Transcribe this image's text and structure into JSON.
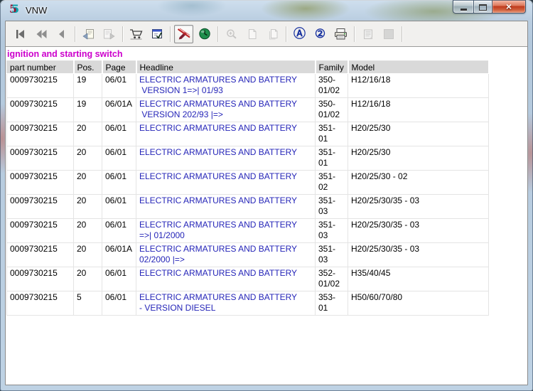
{
  "window": {
    "title": "VNW"
  },
  "caption_buttons": {
    "minimize": "minimize",
    "maximize": "maximize",
    "close": "close"
  },
  "toolbar": {
    "items": [
      {
        "icon": "go-first-icon",
        "enabled": true
      },
      {
        "icon": "go-previous-fast-icon",
        "enabled": true
      },
      {
        "icon": "go-previous-icon",
        "enabled": true
      },
      {
        "separator": true
      },
      {
        "icon": "document-back-icon",
        "enabled": true
      },
      {
        "icon": "document-forward-icon",
        "enabled": false
      },
      {
        "separator": true
      },
      {
        "icon": "shopping-cart-icon",
        "enabled": true
      },
      {
        "icon": "order-form-icon",
        "enabled": true
      },
      {
        "separator": true
      },
      {
        "icon": "no-edit-pen-icon",
        "enabled": true,
        "pressed": true
      },
      {
        "icon": "globe-clock-icon",
        "enabled": true
      },
      {
        "separator": true
      },
      {
        "icon": "zoom-in-icon",
        "enabled": false
      },
      {
        "icon": "page-blank-icon",
        "enabled": false
      },
      {
        "icon": "page-copy-icon",
        "enabled": false
      },
      {
        "separator": true
      },
      {
        "icon": "circled-a-icon",
        "enabled": true,
        "glyph": "Ⓐ"
      },
      {
        "icon": "circled-2-icon",
        "enabled": true,
        "glyph": "②"
      },
      {
        "icon": "printer-icon",
        "enabled": true
      },
      {
        "separator": true
      },
      {
        "icon": "notepad-icon",
        "enabled": false
      },
      {
        "icon": "stop-square-icon",
        "enabled": false
      },
      {
        "separator": true
      }
    ]
  },
  "section_title": "ignition and starting switch",
  "table": {
    "columns": [
      "part number",
      "Pos.",
      "Page",
      "Headline",
      "Family",
      "Model"
    ],
    "rows": [
      {
        "part_number": "0009730215",
        "pos": "19",
        "page": "06/01",
        "headline": "ELECTRIC ARMATURES AND BATTERY\n VERSION 1=>| 01/93",
        "family": "350-01/02",
        "model": "H12/16/18"
      },
      {
        "part_number": "0009730215",
        "pos": "19",
        "page": "06/01A",
        "headline": "ELECTRIC ARMATURES AND BATTERY\n VERSION 202/93 |=>",
        "family": "350-01/02",
        "model": "H12/16/18"
      },
      {
        "part_number": "0009730215",
        "pos": "20",
        "page": "06/01",
        "headline": "ELECTRIC ARMATURES AND BATTERY",
        "family": "351-01",
        "model": "H20/25/30"
      },
      {
        "part_number": "0009730215",
        "pos": "20",
        "page": "06/01",
        "headline": "ELECTRIC ARMATURES AND BATTERY",
        "family": "351-01",
        "model": "H20/25/30"
      },
      {
        "part_number": "0009730215",
        "pos": "20",
        "page": "06/01",
        "headline": "ELECTRIC ARMATURES AND BATTERY",
        "family": "351-02",
        "model": "H20/25/30 - 02"
      },
      {
        "part_number": "0009730215",
        "pos": "20",
        "page": "06/01",
        "headline": "ELECTRIC ARMATURES AND BATTERY",
        "family": "351-03",
        "model": "H20/25/30/35 - 03"
      },
      {
        "part_number": "0009730215",
        "pos": "20",
        "page": "06/01",
        "headline": "ELECTRIC ARMATURES AND BATTERY\n=>| 01/2000",
        "family": "351-03",
        "model": "H20/25/30/35 - 03"
      },
      {
        "part_number": "0009730215",
        "pos": "20",
        "page": "06/01A",
        "headline": "ELECTRIC ARMATURES AND BATTERY\n02/2000 |=>",
        "family": "351-03",
        "model": "H20/25/30/35 - 03"
      },
      {
        "part_number": "0009730215",
        "pos": "20",
        "page": "06/01",
        "headline": "ELECTRIC ARMATURES AND BATTERY",
        "family": "352-01/02",
        "model": "H35/40/45"
      },
      {
        "part_number": "0009730215",
        "pos": "5",
        "page": "06/01",
        "headline": "ELECTRIC ARMATURES AND BATTERY\n- VERSION DIESEL",
        "family": "353-01",
        "model": "H50/60/70/80"
      }
    ]
  },
  "colors": {
    "section_title": "#cc00cc",
    "headline_link": "#2525b8",
    "header_bg": "#d9d9d9",
    "close_button_red": "#c03a1d"
  }
}
